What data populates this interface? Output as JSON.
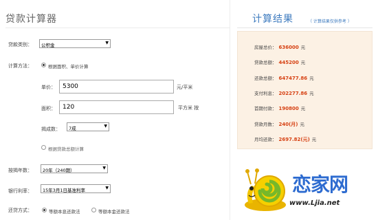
{
  "calculator": {
    "title": "贷款计算器",
    "loan_type": {
      "label": "贷款类别：",
      "value": "公积金"
    },
    "calc_method": {
      "label": "计算方法：",
      "option_area": "根据面积、单价计算",
      "option_total": "根据贷款总额计算"
    },
    "unit_price": {
      "label": "单价：",
      "value": "5300",
      "unit": "元/平米"
    },
    "area": {
      "label": "面积：",
      "value": "120",
      "unit": "平方米 按"
    },
    "down_ratio": {
      "label": "揭成数：",
      "value": "7成"
    },
    "years": {
      "label": "按揭年数：",
      "value": "20年（240期）"
    },
    "rate": {
      "label": "银行利率：",
      "value": "15年3月1日基准利率"
    },
    "repay": {
      "label": "还贷方式：",
      "option_equal_interest": "等额本息还款法",
      "option_equal_principal": "等额本金还款法"
    }
  },
  "result": {
    "title": "计算结果",
    "note": "（ 计算结果仅供参考 ）",
    "rows": [
      {
        "label": "房屋总价：",
        "value": "636000",
        "unit": "元"
      },
      {
        "label": "贷款总额：",
        "value": "445200",
        "unit": "元"
      },
      {
        "label": "还款总额：",
        "value": "647477.86",
        "unit": "元"
      },
      {
        "label": "支付利息：",
        "value": "202277.86",
        "unit": "元"
      },
      {
        "label": "首期付款：",
        "value": "190800",
        "unit": "元"
      },
      {
        "label": "贷款月数：",
        "value": "240(月)",
        "unit": "元"
      },
      {
        "label": "月均还款：",
        "value": "2697.82(元)",
        "unit": "元"
      }
    ]
  },
  "logo": {
    "brand": "恋家网",
    "url": "www.Ljia.net"
  },
  "icons": {
    "dropdown": "chevron-down-icon",
    "mascot": "snail-mascot-icon"
  },
  "colors": {
    "accent": "#3e7bbf",
    "result_value": "#d64012",
    "panel_bg": "#fcf1e4",
    "brand": "#2e6cd0"
  }
}
